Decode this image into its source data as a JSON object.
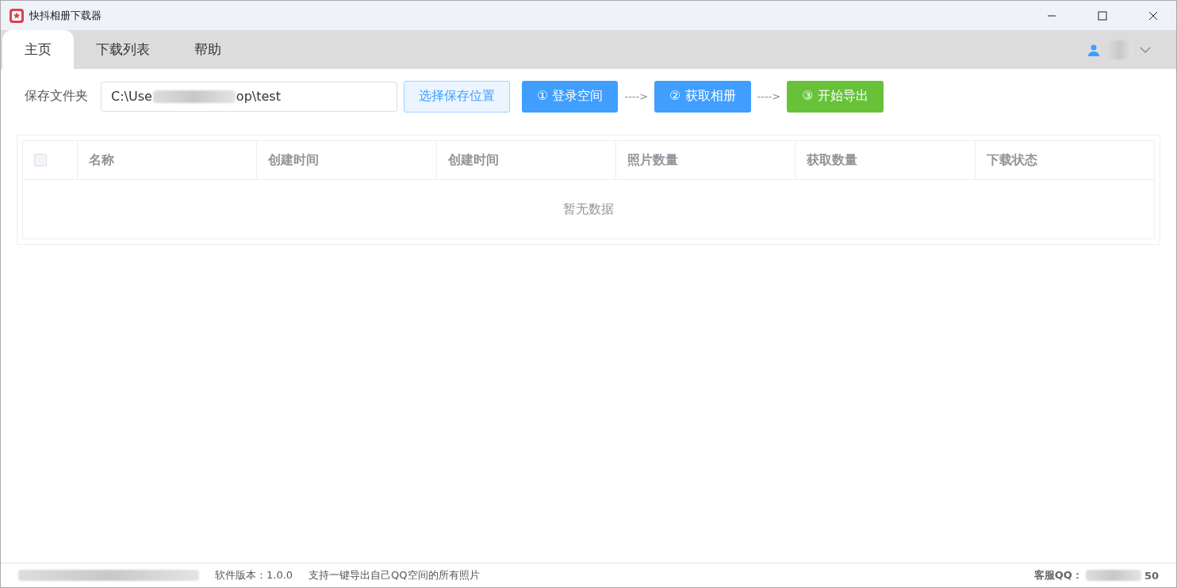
{
  "window": {
    "title": "快抖相册下载器"
  },
  "tabs": [
    {
      "label": "主页",
      "selected": true
    },
    {
      "label": "下载列表",
      "selected": false
    },
    {
      "label": "帮助",
      "selected": false
    }
  ],
  "save_folder": {
    "label": "保存文件夹",
    "value_start": "C:\\Use",
    "value_end": "op\\test",
    "choose_button": "选择保存位置"
  },
  "steps": [
    {
      "label": "① 登录空间",
      "color": "#409eff"
    },
    {
      "label": "② 获取相册",
      "color": "#409eff"
    },
    {
      "label": "③ 开始导出",
      "color": "#67c23a"
    }
  ],
  "step_arrow": "---->",
  "table": {
    "select_all_checked": false,
    "columns": [
      "名称",
      "创建时间",
      "创建时间",
      "照片数量",
      "获取数量",
      "下载状态"
    ],
    "empty_text": "暂无数据"
  },
  "status_bar": {
    "version": "软件版本：1.0.0",
    "description": "支持一键导出自己QQ空间的所有照片",
    "support_label": "客服QQ：",
    "support_end": "50"
  }
}
